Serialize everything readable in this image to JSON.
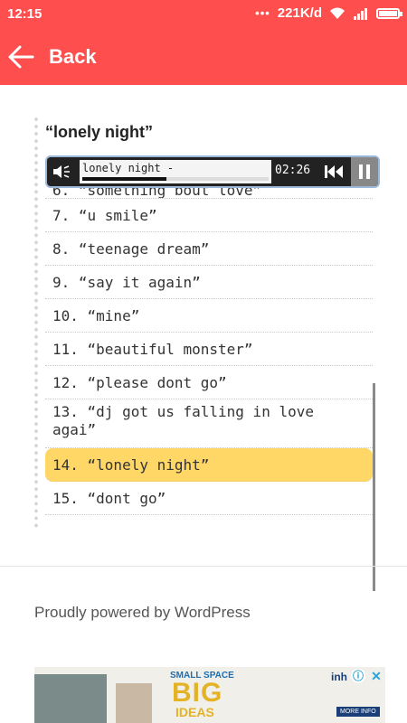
{
  "status_bar": {
    "time": "12:15",
    "dots": "•••",
    "network_speed": "221K/d"
  },
  "app_bar": {
    "back_label": "Back",
    "color": "#ff4e4e"
  },
  "song": {
    "title": "“lonely night”"
  },
  "player": {
    "track_title": "lonely night -",
    "elapsed": "02:26",
    "progress": 0.45
  },
  "playlist": {
    "partial_item": "6. “something bout love”",
    "items": [
      {
        "label": "7. “u smile”"
      },
      {
        "label": "8. “teenage dream”"
      },
      {
        "label": "9. “say it again”"
      },
      {
        "label": "10. “mine”"
      },
      {
        "label": "11. “beautiful monster”"
      },
      {
        "label": "12. “please dont go”"
      },
      {
        "label": "13. “dj got us falling in love agai”"
      },
      {
        "label": "14. “lonely night”"
      },
      {
        "label": "15. “dont go”"
      }
    ],
    "active_color": "#ffd767"
  },
  "footer": {
    "text": "Proudly powered by WordPress"
  },
  "ad": {
    "headline_small": "SMALL SPACE",
    "headline_big": "BIG",
    "headline_sub": "IDEAS",
    "advertiser": "inh",
    "cta": "MORE INFO",
    "info_icon": "ⓘ",
    "close_icon": "✕"
  }
}
